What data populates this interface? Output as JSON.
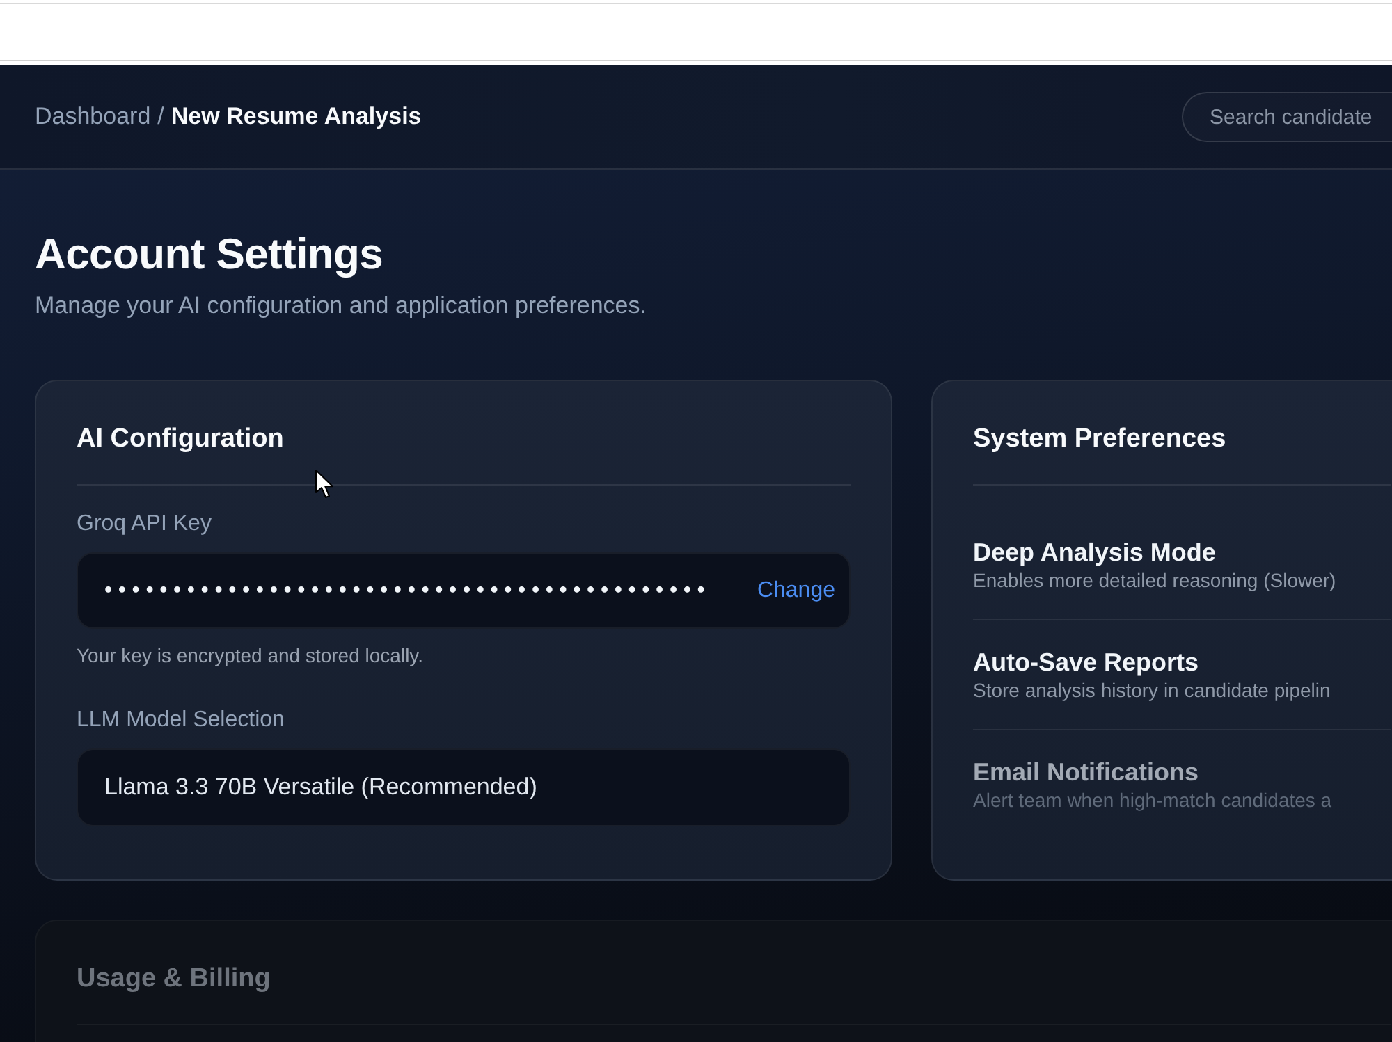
{
  "breadcrumb": {
    "parent": "Dashboard",
    "separator": "/",
    "current": "New Resume Analysis"
  },
  "search": {
    "placeholder": "Search candidate"
  },
  "page": {
    "title": "Account Settings",
    "subtitle": "Manage your AI configuration and application preferences."
  },
  "ai_configuration": {
    "title": "AI Configuration",
    "api_key": {
      "label": "Groq API Key",
      "value": "••••••••••••••••••••••••••••••••••••••••••••",
      "action": "Change",
      "hint": "Your key is encrypted and stored locally."
    },
    "model": {
      "label": "LLM Model Selection",
      "value": "Llama 3.3 70B Versatile (Recommended)"
    }
  },
  "system_preferences": {
    "title": "System Preferences",
    "items": [
      {
        "title": "Deep Analysis Mode",
        "description": "Enables more detailed reasoning (Slower)",
        "dimmed": false
      },
      {
        "title": "Auto-Save Reports",
        "description": "Store analysis history in candidate pipelin",
        "dimmed": false
      },
      {
        "title": "Email Notifications",
        "description": "Alert team when high-match candidates a",
        "dimmed": true
      }
    ]
  },
  "usage_billing": {
    "title": "Usage & Billing",
    "dimmed": true
  }
}
